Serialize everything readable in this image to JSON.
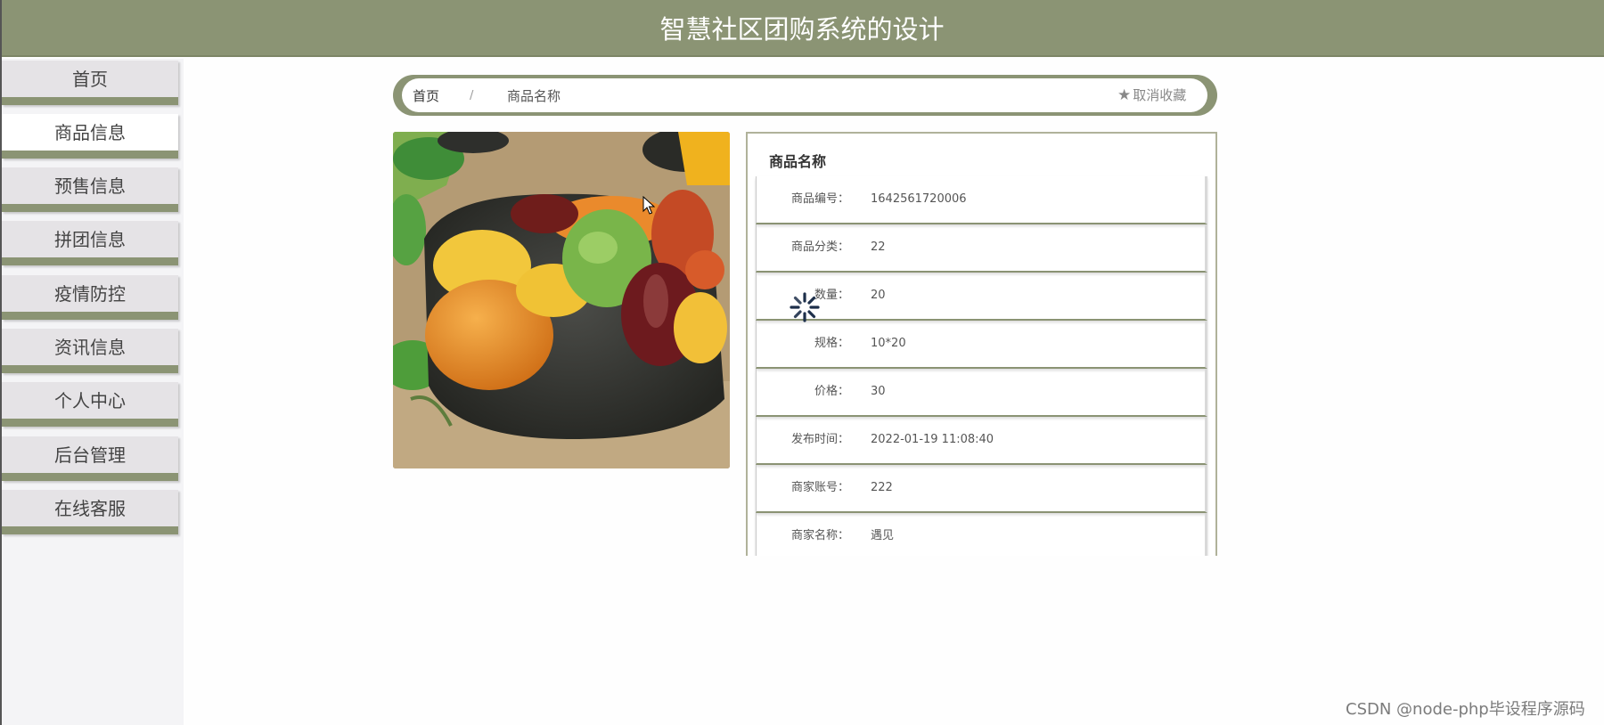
{
  "header": {
    "title": "智慧社区团购系统的设计"
  },
  "sidebar": {
    "items": [
      {
        "label": "首页"
      },
      {
        "label": "商品信息"
      },
      {
        "label": "预售信息"
      },
      {
        "label": "拼团信息"
      },
      {
        "label": "疫情防控"
      },
      {
        "label": "资讯信息"
      },
      {
        "label": "个人中心"
      },
      {
        "label": "后台管理"
      },
      {
        "label": "在线客服"
      }
    ],
    "active_index": 1
  },
  "breadcrumb": {
    "home": "首页",
    "separator": "/",
    "current": "商品名称",
    "favorite_label": "取消收藏"
  },
  "product": {
    "name": "商品名称",
    "fields": [
      {
        "label": "商品编号：",
        "value": "1642561720006"
      },
      {
        "label": "商品分类：",
        "value": "22"
      },
      {
        "label": "数量：",
        "value": "20"
      },
      {
        "label": "规格：",
        "value": "10*20"
      },
      {
        "label": "价格：",
        "value": "30"
      },
      {
        "label": "发布时间：",
        "value": "2022-01-19 11:08:40"
      },
      {
        "label": "商家账号：",
        "value": "222"
      },
      {
        "label": "商家名称：",
        "value": "遇见"
      }
    ]
  },
  "watermark": "CSDN @node-php毕设程序源码",
  "colors": {
    "accent": "#8b9474",
    "nav_bg": "#e5e3e6",
    "sidebar_bg": "#f4f4f6"
  }
}
